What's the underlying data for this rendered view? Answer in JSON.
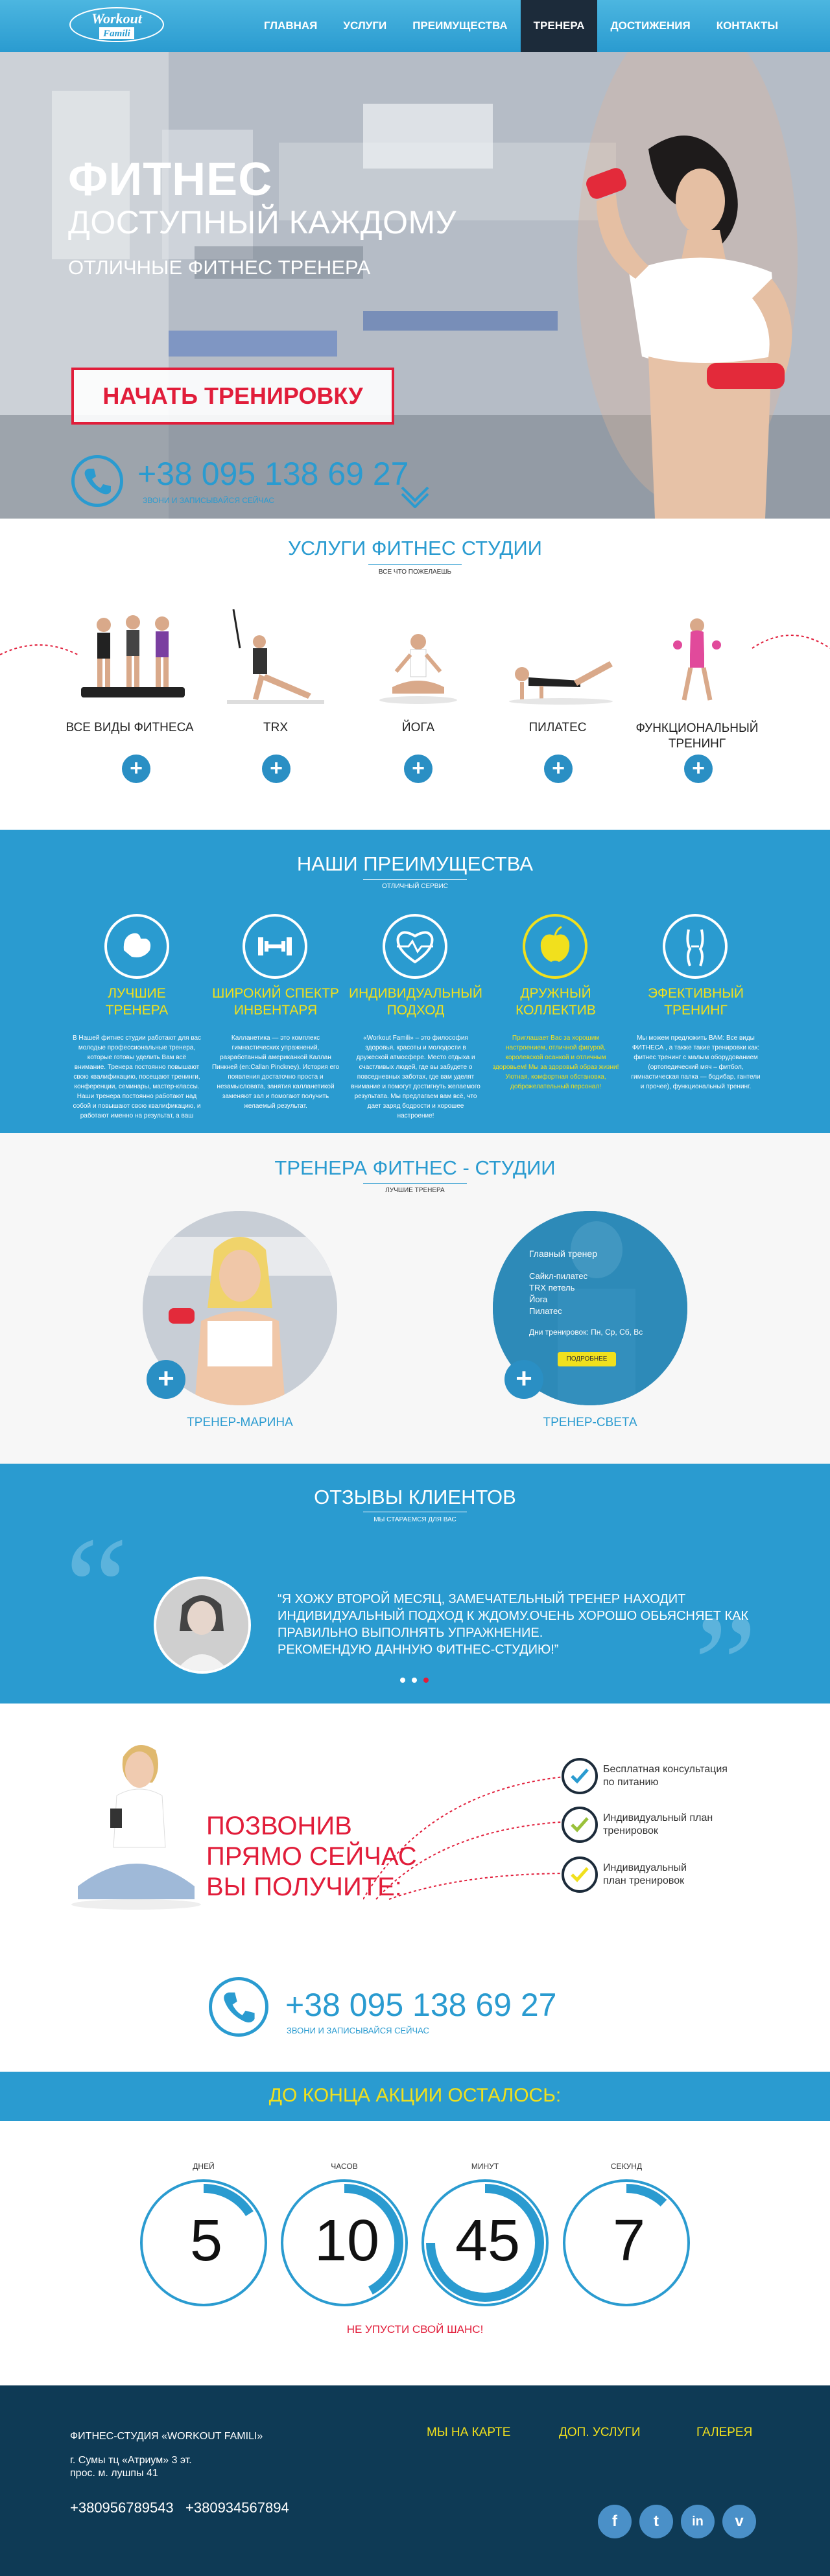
{
  "nav": {
    "logo_text_1": "Workout",
    "logo_text_2": "Famili",
    "items": [
      "ГЛАВНАЯ",
      "УСЛУГИ",
      "ПРЕИМУЩЕСТВА",
      "ТРЕНЕРА",
      "ДОСТИЖЕНИЯ",
      "КОНТАКТЫ"
    ],
    "active": "ТРЕНЕРА"
  },
  "hero": {
    "title_1": "ФИТНЕС",
    "title_2": "ДОСТУПНЫЙ КАЖДОМУ",
    "subtitle": "ОТЛИЧНЫЕ ФИТНЕС ТРЕНЕРА",
    "cta": "НАЧАТЬ ТРЕНИРОВКУ",
    "phone": "+38 095 138 69 27",
    "phone_sub": "ЗВОНИ И ЗАПИСЫВАЙСЯ СЕЙЧАС"
  },
  "services": {
    "title": "УСЛУГИ ФИТНЕС СТУДИИ",
    "subtitle": "ВСЕ ЧТО ПОЖЕЛАЕШЬ",
    "items": [
      {
        "label": "ВСЕ ВИДЫ ФИТНЕСА"
      },
      {
        "label": "TRX"
      },
      {
        "label": "ЙОГА"
      },
      {
        "label": "ПИЛАТЕС"
      },
      {
        "label_1": "ФУНКЦИОНАЛЬНЫЙ",
        "label_2": "ТРЕНИНГ"
      }
    ],
    "plus": "+"
  },
  "advantages": {
    "title": "НАШИ ПРЕИМУЩЕСТВА",
    "subtitle": "ОТЛИЧНЫЙ СЕРВИС",
    "items": [
      {
        "title_1": "ЛУЧШИЕ",
        "title_2": "ТРЕНЕРА",
        "text": "В Нашей фитнес студии работают для вас молодые профессиональные тренера, которые готовы уделить Вам всё внимание. Тренера постоянно повышают свою квалификацию, посещают тренинги, конференции, семинары, мастер-классы. Наши тренера постоянно работают над собой и повышают свою квалификацию, и работают именно на результат, а ваш результат - это наш успех!"
      },
      {
        "title_1": "ШИРОКИЙ СПЕКТР",
        "title_2": "ИНВЕНТАРЯ",
        "text": "Калланетика — это комплекс гимнастических упражнений, разработанный американкой Каллан Пинкней (en:Callan Pinckney). История его появления достаточно проста и незамысловата, занятия калланетикой заменяют зал и помогают получить желаемый результат."
      },
      {
        "title_1": "ИНДИВИДУАЛЬНЫЙ",
        "title_2": "ПОДХОД",
        "text": "«Workout Famili» – это философия здоровья, красоты и молодости в дружеской атмосфере. Место отдыха и счастливых людей, где вы забудете о повседневных заботах, где вам уделят внимание и помогут достигнуть желаемого результата. Мы предлагаем вам всё, что дает заряд бодрости и хорошее настроение!"
      },
      {
        "title_1": "ДРУЖНЫЙ",
        "title_2": "КОЛЛЕКТИВ",
        "text": "Приглашает Вас за хорошим настроением, отличной фигурой, королевской осанкой и отличным здоровьем! Мы за здоровый образ жизни! Уютная, комфортная обстановка, доброжелательный персонал!"
      },
      {
        "title_1": "ЭФЕКТИВНЫЙ",
        "title_2": "ТРЕНИНГ",
        "text": "Мы можем предложить ВАМ: Все виды ФИТНЕСА , а также такие тренировки как: фитнес тренинг с малым оборудованием (ортопедический мяч – фитбол, гимнастическая палка — бодибар, гантели и прочее), функциональный тренинг."
      }
    ]
  },
  "trainers": {
    "title": "ТРЕНЕРА ФИТНЕС - СТУДИИ",
    "subtitle": "ЛУЧШИЕ ТРЕНЕРА",
    "items": [
      {
        "name": "ТРЕНЕР-МАРИНА"
      },
      {
        "name": "ТРЕНЕР-СВЕТА",
        "overlay_title": "Главный тренер",
        "overlay_lines": [
          "Сайкл-пилатес",
          "TRX петель",
          "Йога",
          "Пилатес"
        ],
        "overlay_days": "Дни тренировок: Пн, Ср, Сб, Вс",
        "overlay_button": "ПОДРОБНЕЕ"
      }
    ]
  },
  "reviews": {
    "title": "ОТЗЫВЫ КЛИЕНТОВ",
    "subtitle": "МЫ СТАРАЕМСЯ ДЛЯ ВАС",
    "quote_1": "“Я ХОЖУ ВТОРОЙ МЕСЯЦ, ЗАМЕЧАТЕЛЬНЫЙ ТРЕНЕР НАХОДИТ",
    "quote_2": "ИНДИВИДУАЛЬНЫЙ ПОДХОД  К ЖДОМУ.ОЧЕНЬ ХОРОШО ОБЬЯСНЯЕТ КАК",
    "quote_3": "ПРАВИЛЬНО ВЫПОЛНЯТЬ УПРАЖНЕНИЕ.",
    "quote_4": "РЕКОМЕНДУЮ ДАННУЮ ФИТНЕС-СТУДИЮ!”",
    "open_quote": "“",
    "close_quote": "”"
  },
  "call": {
    "heading_1": "ПОЗВОНИВ",
    "heading_2": "ПРЯМО СЕЙЧАС",
    "heading_3": "ВЫ ПОЛУЧИТЕ:",
    "benefits": [
      {
        "line_1": "Бесплатная консультация",
        "line_2": "по питанию"
      },
      {
        "line_1": "Индивидуальный план",
        "line_2": "тренировок"
      },
      {
        "line_1": "Индивидуальный",
        "line_2": "план тренировок"
      }
    ],
    "phone": "+38 095 138 69 27",
    "phone_sub": "ЗВОНИ И ЗАПИСЫВАЙСЯ СЕЙЧАС"
  },
  "promo": {
    "title": "ДО КОНЦА АКЦИИ ОСТАЛОСЬ:",
    "units": [
      {
        "label": "ДНЕЙ",
        "value": "5",
        "fraction": 0.16
      },
      {
        "label": "ЧАСОВ",
        "value": "10",
        "fraction": 0.42
      },
      {
        "label": "МИНУТ",
        "value": "45",
        "fraction": 0.75
      },
      {
        "label": "СЕКУНД",
        "value": "7",
        "fraction": 0.12
      }
    ],
    "footer_note": "НЕ УПУСТИ СВОЙ ШАНС!"
  },
  "footer": {
    "company": "ФИТНЕС-СТУДИЯ «WORKOUT FAMILI»",
    "address_1": "г. Сумы тц «Атриум» 3 эт.",
    "address_2": "прос. м. лушпы 41",
    "phones": "+380956789543   +380934567894",
    "links": [
      "МЫ НА КАРТЕ",
      "ДОП. УСЛУГИ",
      "ГАЛЕРЕЯ"
    ],
    "social": [
      "f",
      "t",
      "in",
      "v"
    ]
  },
  "colors": {
    "primary": "#2a9bd0",
    "accent_red": "#e11d3a",
    "accent_yellow": "#f1e01d",
    "footer": "#0e3a55"
  }
}
